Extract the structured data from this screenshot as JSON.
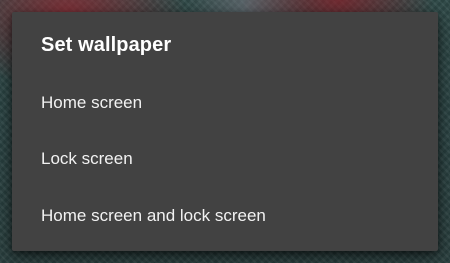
{
  "dialog": {
    "title": "Set wallpaper",
    "options": [
      {
        "label": "Home screen"
      },
      {
        "label": "Lock screen"
      },
      {
        "label": "Home screen and lock screen"
      }
    ]
  }
}
